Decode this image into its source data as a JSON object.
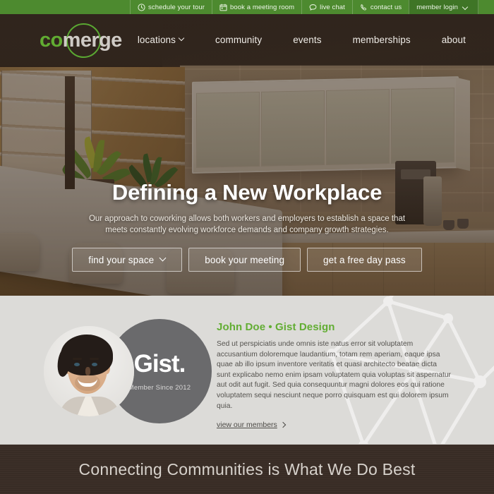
{
  "topbar": {
    "items": [
      {
        "label": "schedule your tour",
        "icon": "clock-icon",
        "has_caret": false
      },
      {
        "label": "book a meeting room",
        "icon": "calendar-icon",
        "has_caret": false
      },
      {
        "label": "live chat",
        "icon": "chat-bubble-icon",
        "has_caret": false
      },
      {
        "label": "contact us",
        "icon": "phone-icon",
        "has_caret": false
      },
      {
        "label": "member login",
        "icon": "",
        "has_caret": true
      }
    ],
    "background_color": "#4d8a2f",
    "active_background_color": "#3f7526"
  },
  "header": {
    "logo": {
      "part1": "co",
      "part2": "merge",
      "part1_color": "#61ac32",
      "part2_color": "#cfcbc6",
      "ring_color": "#5aa832"
    },
    "nav": [
      {
        "label": "locations",
        "has_caret": true
      },
      {
        "label": "community",
        "has_caret": false
      },
      {
        "label": "events",
        "has_caret": false
      },
      {
        "label": "memberships",
        "has_caret": false
      },
      {
        "label": "about",
        "has_caret": false
      }
    ]
  },
  "hero": {
    "heading": "Defining a New Workplace",
    "subheading": "Our approach to coworking allows both workers and employers to establish a space that meets constantly evolving workforce demands and company growth strategies.",
    "buttons": [
      {
        "label": "find your space",
        "has_caret": true
      },
      {
        "label": "book your meeting",
        "has_caret": false
      },
      {
        "label": "get a free day pass",
        "has_caret": false
      }
    ]
  },
  "testimonial": {
    "avatar_alt": "member-portrait",
    "badge": {
      "word": "Gist",
      "dot": ".",
      "subtitle": "Member Since 2012",
      "background_color": "#6a6a6c"
    },
    "name": "John Doe • Gist Design",
    "name_color": "#62ad33",
    "quote": "Sed ut perspiciatis unde omnis iste natus error sit voluptatem accusantium doloremque laudantium, totam rem aperiam, eaque ipsa quae ab illo ipsum inventore veritatis et quasi architecto beatae dicta sunt explicabo nemo enim ipsam voluptatem quia voluptas sit aspernatur aut odit aut fugit. Sed quia consequuntur magni dolores eos qui ratione voluptatem sequi nesciunt neque porro quisquam est qui dolorem ipsum quia.",
    "link_label": "view our members",
    "background_color": "#dcdbd8"
  },
  "band": {
    "text": "Connecting Communities is What We Do Best",
    "background_color": "#3a2d26"
  }
}
